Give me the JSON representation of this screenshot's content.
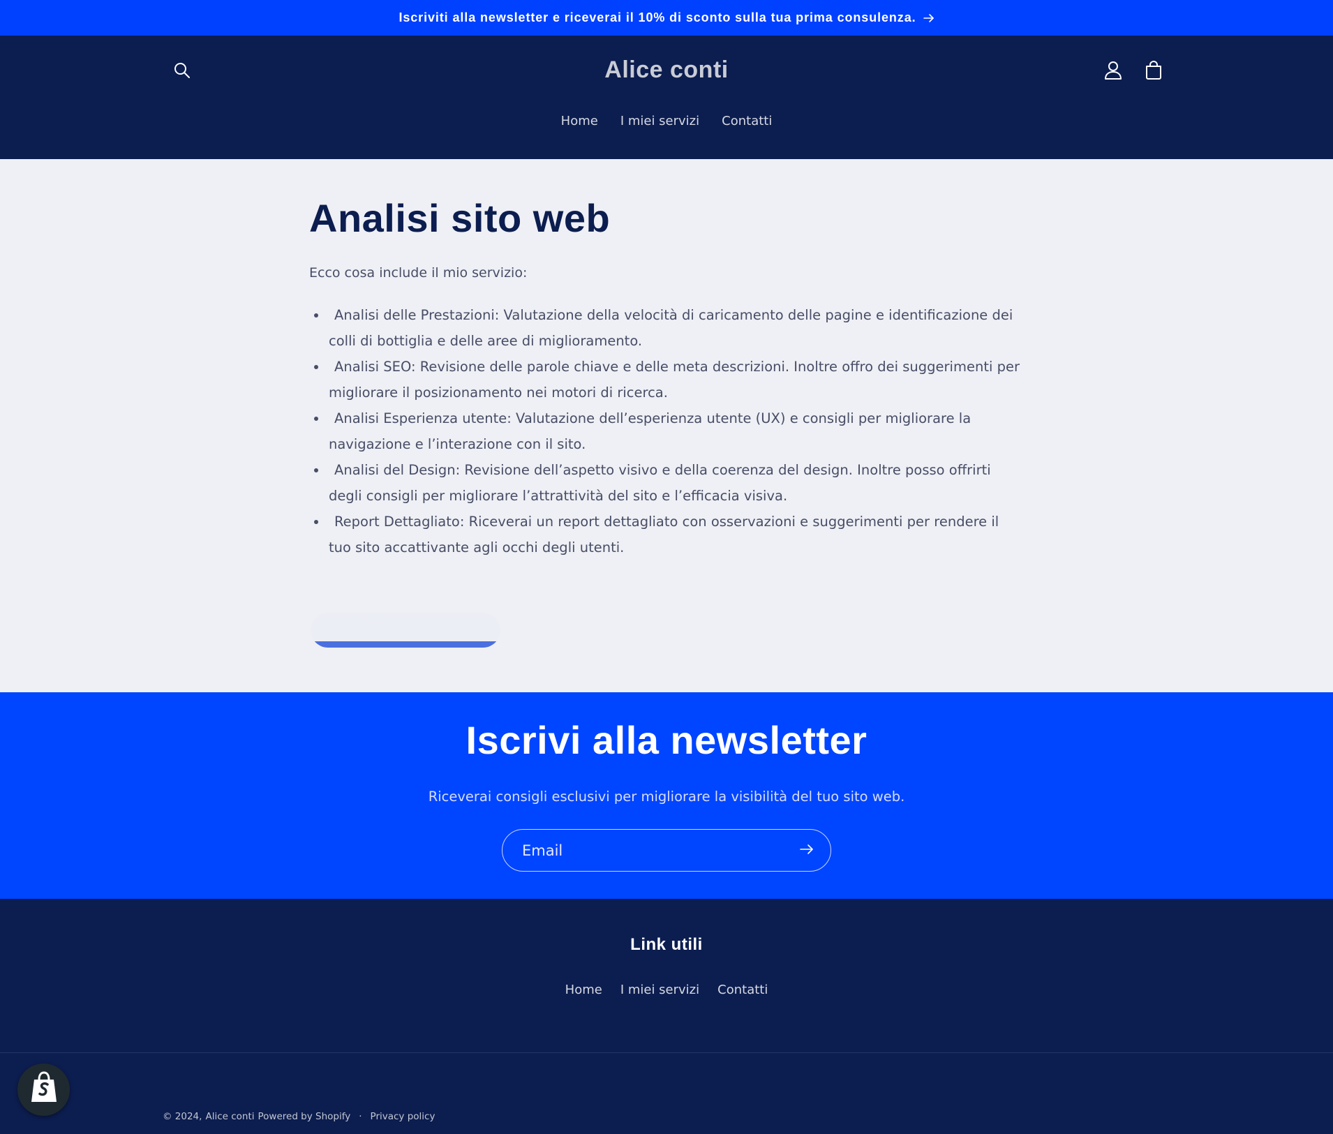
{
  "announcement": {
    "text": "Iscriviti alla newsletter e riceverai il 10% di sconto sulla tua prima consulenza.",
    "arrow_icon": "arrow-right-icon"
  },
  "header": {
    "logo": "Alice conti",
    "icons": [
      "search-icon",
      "account-icon",
      "cart-icon"
    ],
    "nav": [
      "Home",
      "I miei servizi",
      "Contatti"
    ]
  },
  "main": {
    "title": "Analisi sito web",
    "intro": "Ecco cosa include il mio servizio:",
    "features": [
      "Analisi delle Prestazioni: Valutazione della velocità di caricamento delle pagine e identificazione dei colli di bottiglia e delle aree di miglioramento.",
      "Analisi SEO: Revisione delle parole chiave e delle meta descrizioni. Inoltre offro dei suggerimenti per migliorare il posizionamento nei motori di ricerca.",
      "Analisi Esperienza utente: Valutazione dell’esperienza utente (UX) e consigli per migliorare la navigazione e l’interazione con il sito.",
      "Analisi del Design: Revisione dell’aspetto visivo e della coerenza del design. Inoltre posso offrirti degli consigli per migliorare l’attrattività del sito e l’efficacia visiva.",
      "Report Dettagliato: Riceverai un report dettagliato con osservazioni e suggerimenti per rendere il tuo sito accattivante agli occhi degli utenti."
    ],
    "cta_label": ""
  },
  "newsletter": {
    "title": "Iscrivi alla newsletter",
    "subtitle": "Riceverai consigli esclusivi per migliorare la visibilità del tuo sito web.",
    "email_placeholder": "Email",
    "submit_icon": "arrow-right-icon"
  },
  "footer": {
    "heading": "Link utili",
    "links": [
      "Home",
      "I miei servizi",
      "Contatti"
    ],
    "copyright_prefix": "© 2024,",
    "store_name": "Alice conti",
    "powered_by": "Powered by Shopify",
    "separator": "·",
    "privacy": "Privacy policy",
    "badge_icon": "shopify-bag-icon"
  },
  "colors": {
    "announcement_bg": "#0040ff",
    "header_bg": "#0c1d4f",
    "content_bg": "#eff0f5",
    "newsletter_bg": "#0045ff",
    "footer_bg": "#0c1d4f",
    "title_text": "#0c1d4f",
    "body_text": "#474d66"
  }
}
